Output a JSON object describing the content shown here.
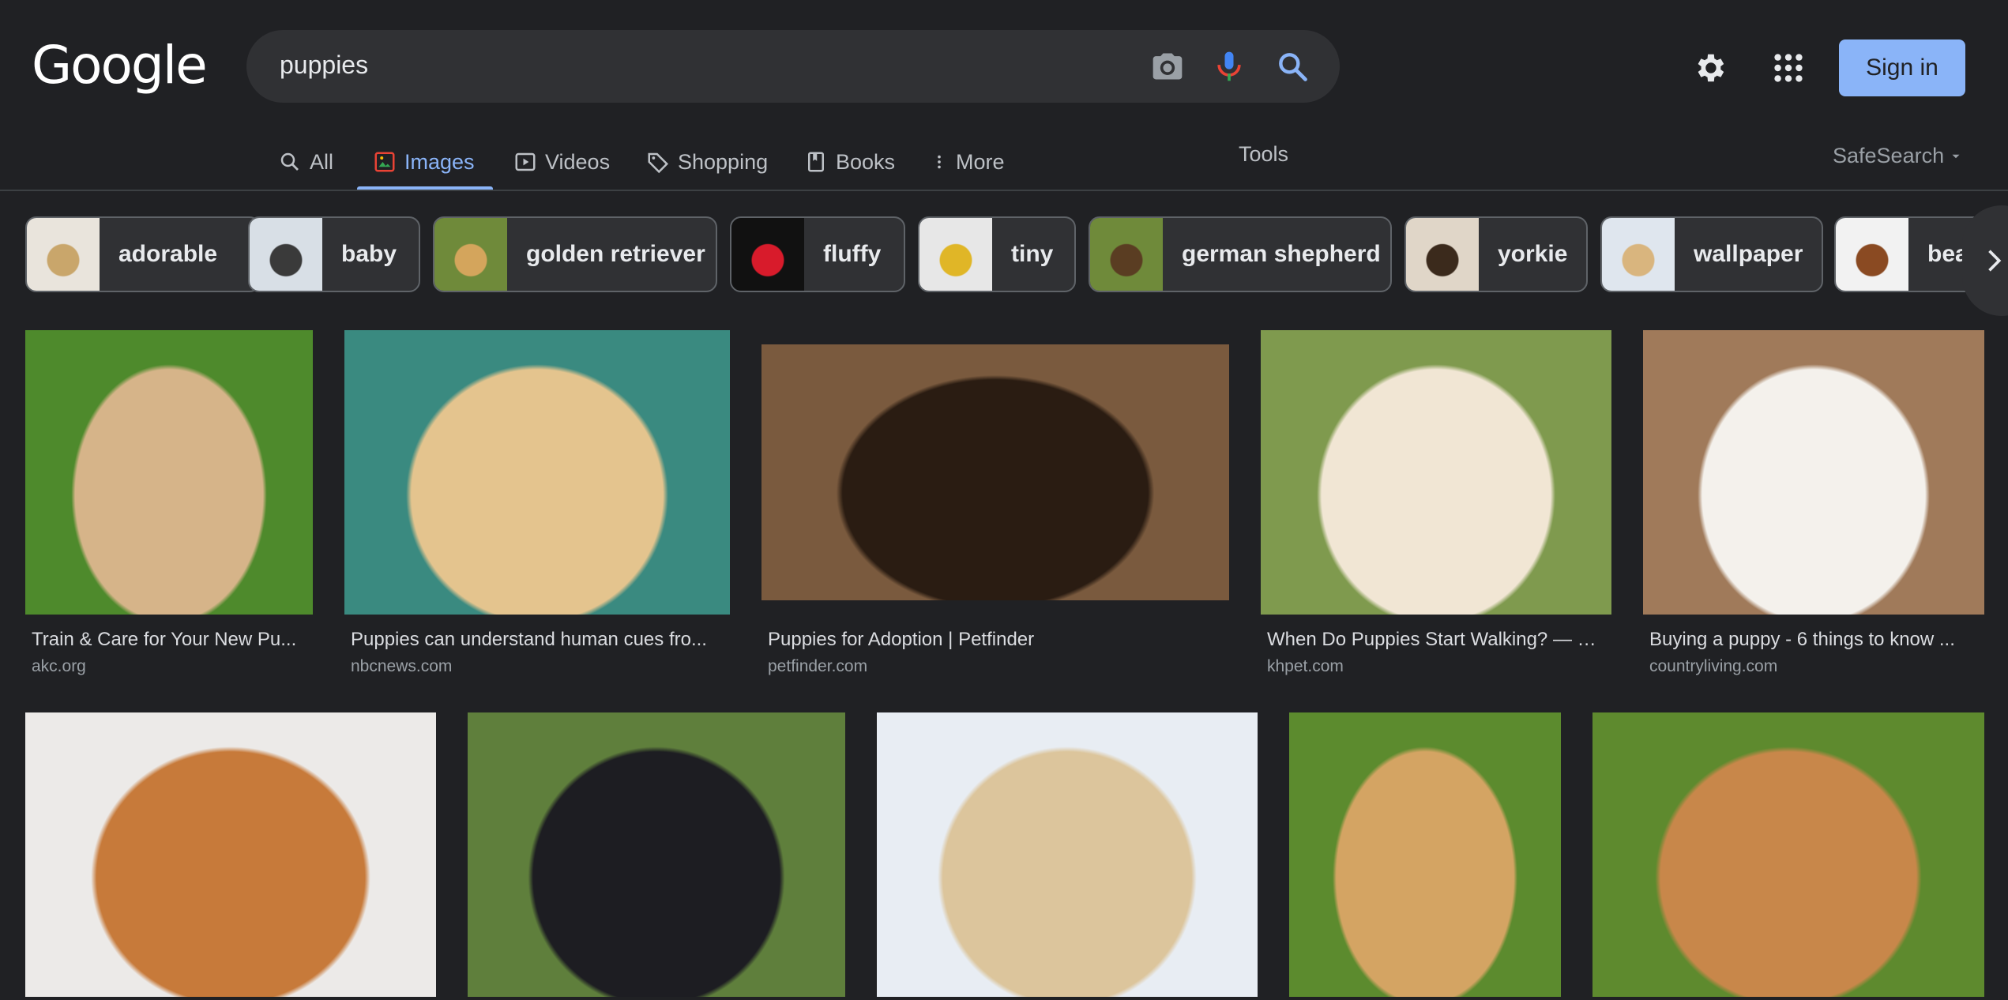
{
  "header": {
    "logo": "Google",
    "search_value": "puppies",
    "sign_in": "Sign in"
  },
  "tabs": {
    "all": "All",
    "images": "Images",
    "videos": "Videos",
    "shopping": "Shopping",
    "books": "Books",
    "more": "More",
    "tools": "Tools",
    "safesearch": "SafeSearch"
  },
  "chips": [
    {
      "label": "adorable",
      "thumb_bg": "#e9e4dc",
      "thumb_fg": "#c9a66b"
    },
    {
      "label": "baby",
      "thumb_bg": "#d8dfe6",
      "thumb_fg": "#3a3a3a"
    },
    {
      "label": "golden retriever",
      "thumb_bg": "#6f8a3a",
      "thumb_fg": "#d4a55c"
    },
    {
      "label": "fluffy",
      "thumb_bg": "#111111",
      "thumb_fg": "#d81b2b"
    },
    {
      "label": "tiny",
      "thumb_bg": "#e7e7e7",
      "thumb_fg": "#e0b627"
    },
    {
      "label": "german shepherd",
      "thumb_bg": "#6f8a3a",
      "thumb_fg": "#5a3d22"
    },
    {
      "label": "yorkie",
      "thumb_bg": "#e0d6c8",
      "thumb_fg": "#3b2a1c"
    },
    {
      "label": "wallpaper",
      "thumb_bg": "#dfe6ee",
      "thumb_fg": "#d9b57e"
    },
    {
      "label": "beagle",
      "thumb_bg": "#f2f2f2",
      "thumb_fg": "#8a4a22"
    }
  ],
  "results": [
    {
      "caption": "Train & Care for Your New Pu...",
      "source": "akc.org",
      "bg": "#4e8a2c",
      "fg": "#d6b489"
    },
    {
      "caption": "Puppies can understand human cues fro...",
      "source": "nbcnews.com",
      "bg": "#3a8a80",
      "fg": "#e4c48e"
    },
    {
      "caption": "Puppies for Adoption | Petfinder",
      "source": "petfinder.com",
      "bg": "#7a5a3e",
      "fg": "#2a1c12"
    },
    {
      "caption": "When Do Puppies Start Walking? — K...",
      "source": "khpet.com",
      "bg": "#7f9a4e",
      "fg": "#f1e6d4"
    },
    {
      "caption": "Buying a puppy - 6 things to know ...",
      "source": "countryliving.com",
      "bg": "#a07a5a",
      "fg": "#f4f1ec"
    },
    {
      "caption": "",
      "source": "",
      "bg": "#eceae8",
      "fg": "#c77a3a"
    },
    {
      "caption": "",
      "source": "",
      "bg": "#5f7f3c",
      "fg": "#1d1d22"
    },
    {
      "caption": "",
      "source": "",
      "bg": "#e8edf3",
      "fg": "#dcc59c"
    },
    {
      "caption": "",
      "source": "",
      "bg": "#5c8b2e",
      "fg": "#d4a463"
    },
    {
      "caption": "",
      "source": "",
      "bg": "#5e8a2e",
      "fg": "#c8874a"
    }
  ],
  "colors": {
    "background": "#202124",
    "accent": "#8ab4f8",
    "chip_border": "#5f6368"
  },
  "icons": [
    "camera-icon",
    "mic-icon",
    "search-icon",
    "gear-icon",
    "apps-grid-icon",
    "chevron-right-icon"
  ]
}
